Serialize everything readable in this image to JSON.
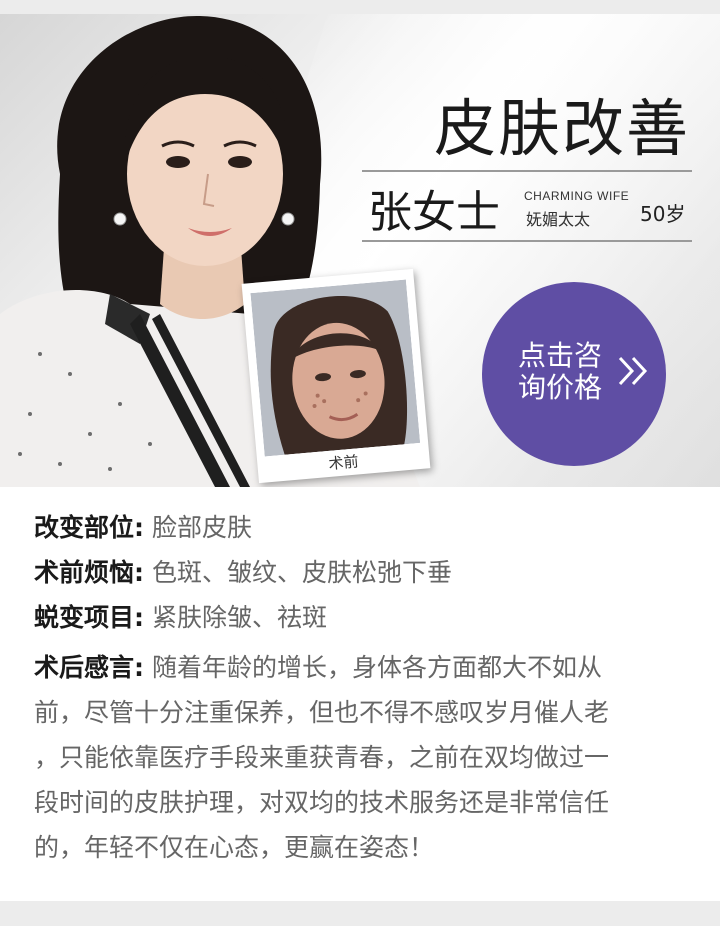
{
  "hero": {
    "title": "皮肤改善",
    "name": "张女士",
    "tagline_en": "CHARMING WIFE",
    "tagline_cn": "妩媚太太",
    "age": "50岁",
    "consult_line1": "点击咨",
    "consult_line2": "询价格",
    "before_label": "术前"
  },
  "details": {
    "area_label": "改变部位:",
    "area_value": "脸部皮肤",
    "concern_label": "术前烦恼:",
    "concern_value": "色斑、皱纹、皮肤松弛下垂",
    "project_label": "蜕变项目:",
    "project_value": "紧肤除皱、祛斑",
    "review_label": "术后感言:",
    "review_lines": [
      "随着年龄的增长，身体各方面都大不如从",
      "前，尽管十分注重保养，但也不得不感叹岁月催人老",
      "，只能依靠医疗手段来重获青春，之前在双均做过一",
      "段时间的皮肤护理，对双均的技术服务还是非常信任",
      "的，年轻不仅在心态，更赢在姿态！"
    ]
  },
  "colors": {
    "accent": "#5f4ea4"
  }
}
